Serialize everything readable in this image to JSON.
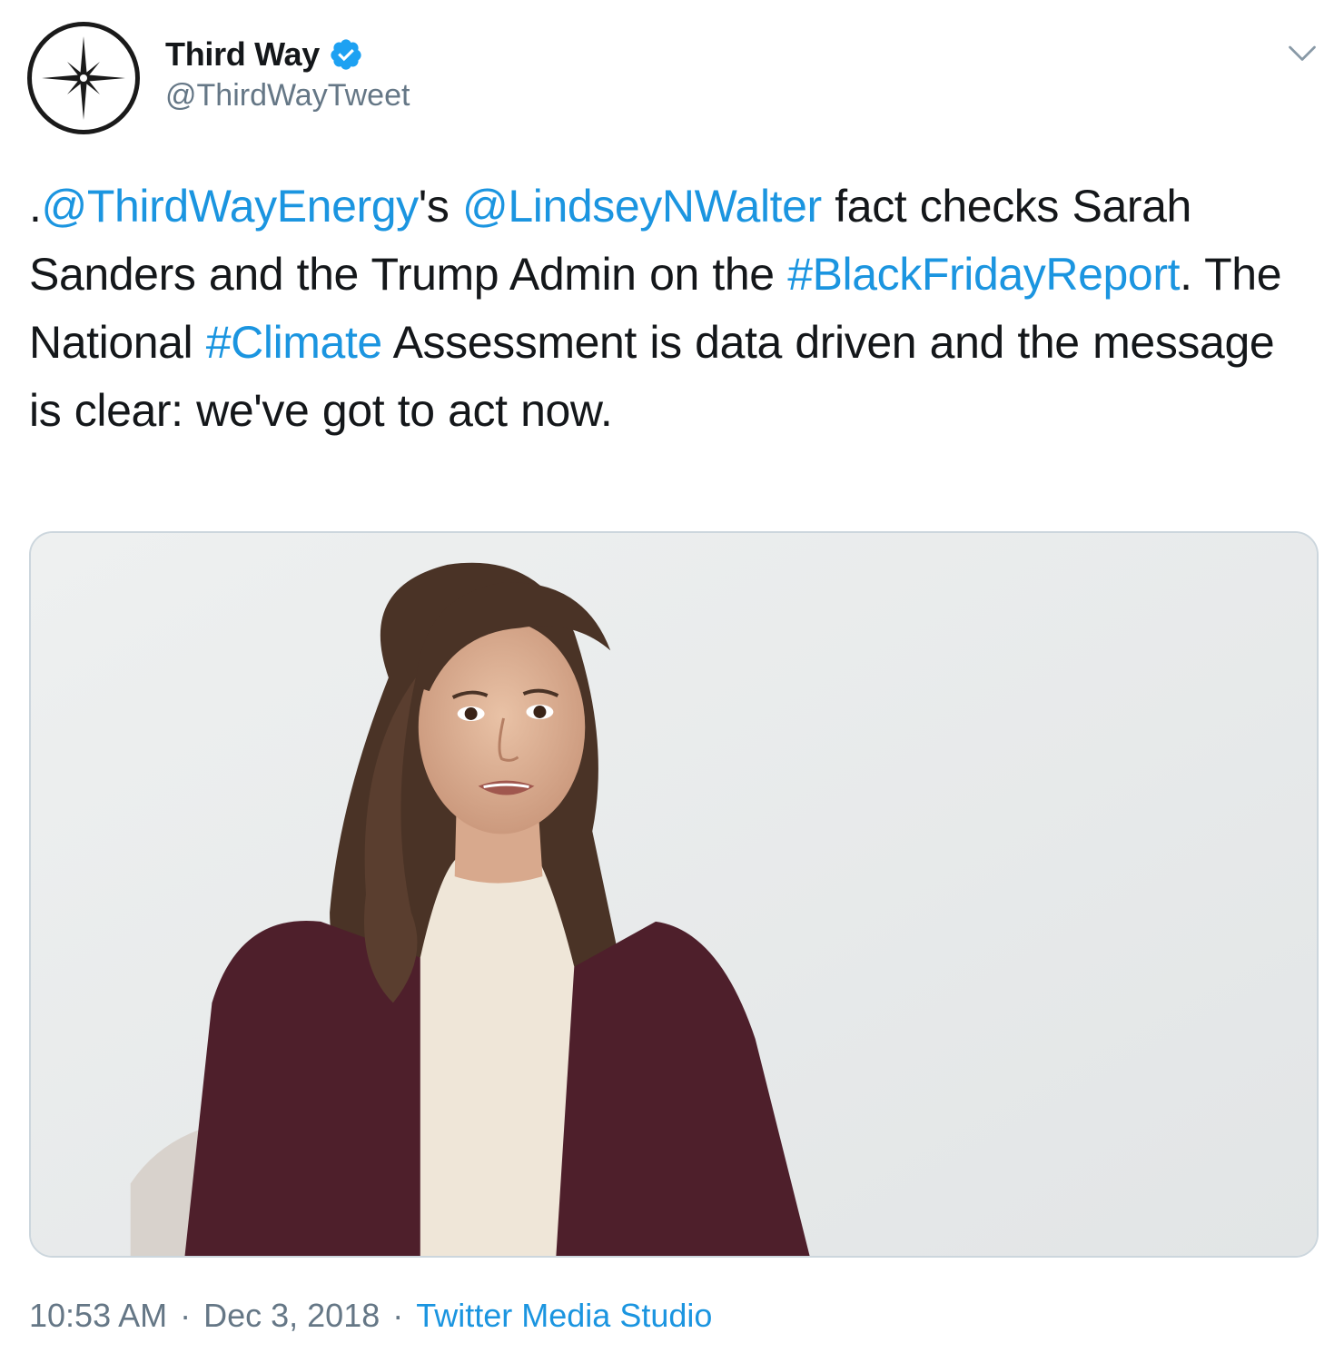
{
  "author": {
    "display_name": "Third Way",
    "handle": "@ThirdWayTweet",
    "verified": true,
    "avatar_icon": "compass-star-icon"
  },
  "tweet": {
    "segments": [
      {
        "text": ".",
        "type": "text"
      },
      {
        "text": "@ThirdWayEnergy",
        "type": "mention"
      },
      {
        "text": "'s ",
        "type": "text"
      },
      {
        "text": "@LindseyNWalter",
        "type": "mention"
      },
      {
        "text": " fact checks Sarah Sanders and the Trump Admin on the ",
        "type": "text"
      },
      {
        "text": "#BlackFridayReport",
        "type": "hashtag"
      },
      {
        "text": ". The National ",
        "type": "text"
      },
      {
        "text": "#Climate",
        "type": "hashtag"
      },
      {
        "text": " Assessment is data driven and the message is clear: we've got to act now.",
        "type": "text"
      }
    ]
  },
  "media": {
    "type": "video-still"
  },
  "footer": {
    "time": "10:53 AM",
    "separator": "·",
    "date": "Dec 3, 2018",
    "source": "Twitter Media Studio"
  },
  "colors": {
    "link": "#1b95e0",
    "text": "#14171a",
    "secondary": "#657786",
    "verified": "#1da1f2",
    "border": "#ccd6dd"
  },
  "icons": {
    "verified": "verified-badge-icon",
    "caret": "chevron-down-icon"
  }
}
